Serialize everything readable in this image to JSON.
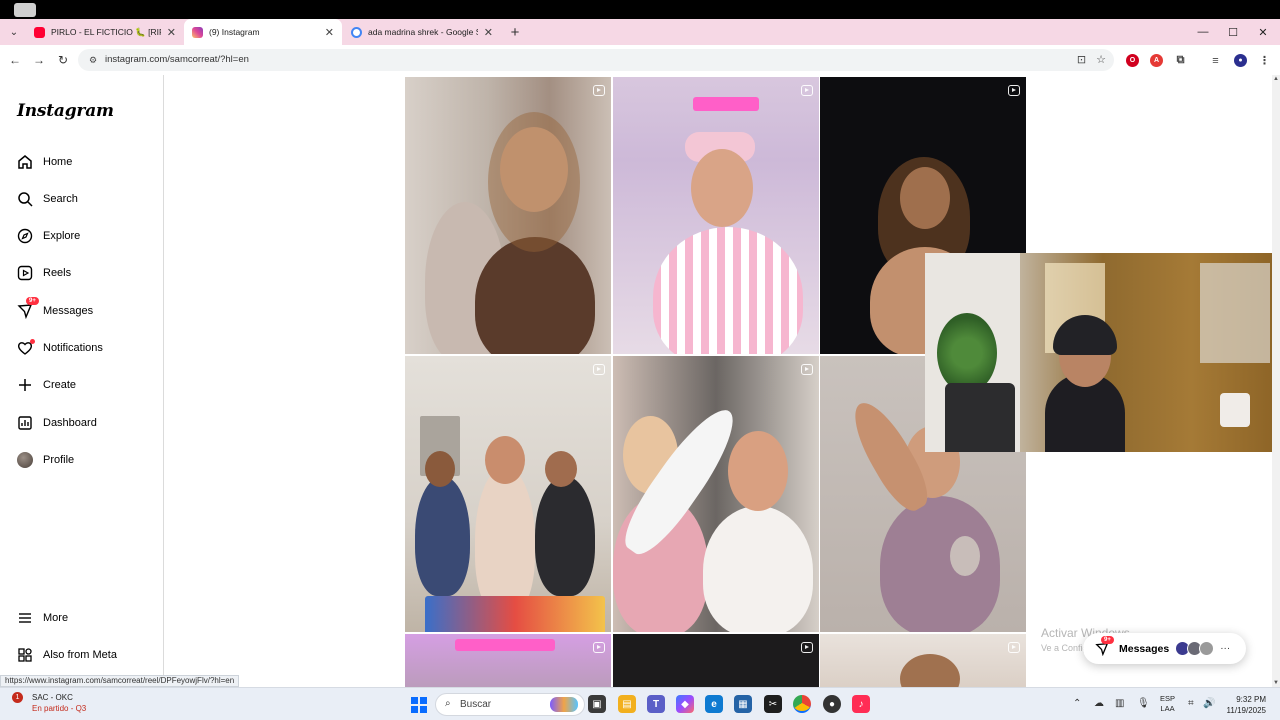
{
  "browser": {
    "tabs": [
      {
        "title": "PIRLO - EL FICTICIO 🐛 [RIP Ble",
        "active": false,
        "favicon_color": "#ff0033"
      },
      {
        "title": "(9) Instagram",
        "active": true,
        "favicon_color": "#d6249f"
      },
      {
        "title": "ada madrina shrek - Google Se",
        "active": false,
        "favicon_color": "#4285f4"
      }
    ],
    "address": "instagram.com/samcorreat/?hl=en",
    "hover_url": "https://www.instagram.com/samcorreat/reel/DPFeyowjFlv/?hl=en"
  },
  "sidebar": {
    "logo": "Instagram",
    "items": [
      {
        "label": "Home",
        "icon": "home-icon"
      },
      {
        "label": "Search",
        "icon": "search-icon"
      },
      {
        "label": "Explore",
        "icon": "compass-icon"
      },
      {
        "label": "Reels",
        "icon": "reels-icon"
      },
      {
        "label": "Messages",
        "icon": "messenger-icon",
        "badge": "9+"
      },
      {
        "label": "Notifications",
        "icon": "heart-icon",
        "dot": true
      },
      {
        "label": "Create",
        "icon": "plus-icon"
      },
      {
        "label": "Dashboard",
        "icon": "dashboard-icon"
      },
      {
        "label": "Profile",
        "icon": "avatar"
      }
    ],
    "more": "More",
    "meta": "Also from Meta"
  },
  "messages_pill": {
    "label": "Messages",
    "badge": "9+"
  },
  "watermark": {
    "line1": "Activar Windows",
    "line2": "Ve a Configuración"
  },
  "taskbar": {
    "game_title": "SAC - OKC",
    "game_status": "En partido - Q3",
    "game_badge": "1",
    "search_placeholder": "Buscar",
    "lang_top": "ESP",
    "lang_bottom": "LAA",
    "time": "9:32 PM",
    "date": "11/19/2025"
  },
  "colors": {
    "tab_strip": "#f6d8e5",
    "notification_red": "#ff3040",
    "windows_blue": "#0a6cff"
  }
}
